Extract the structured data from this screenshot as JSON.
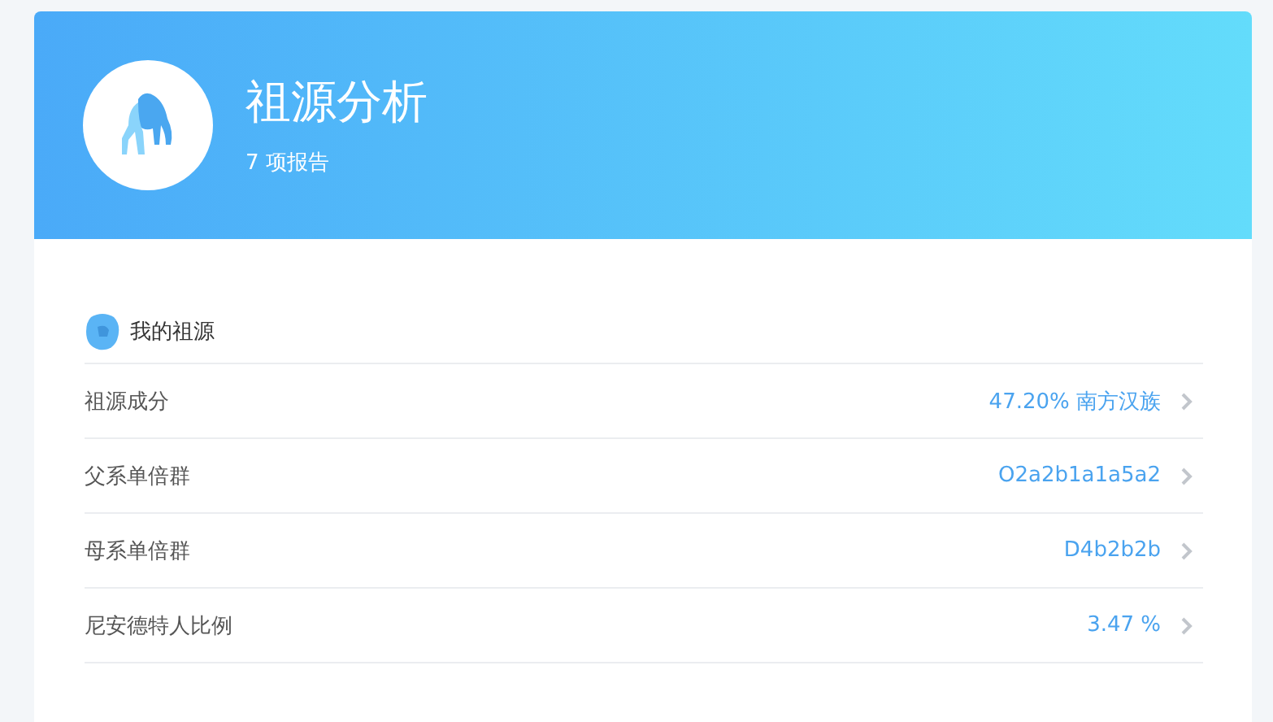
{
  "header": {
    "title": "祖源分析",
    "subtitle": "7 项报告"
  },
  "section": {
    "title": "我的祖源"
  },
  "rows": [
    {
      "label": "祖源成分",
      "value": "47.20% 南方汉族"
    },
    {
      "label": "父系单倍群",
      "value": "O2a2b1a1a5a2"
    },
    {
      "label": "母系单倍群",
      "value": "D4b2b2b"
    },
    {
      "label": "尼安德特人比例",
      "value": "3.47 %"
    }
  ]
}
